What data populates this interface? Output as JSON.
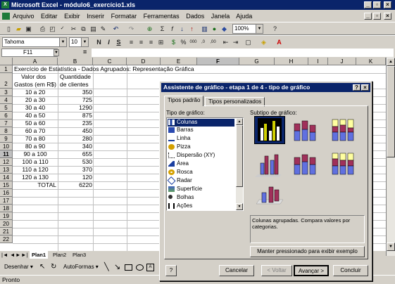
{
  "window": {
    "title": "Microsoft Excel - módulo6_exercício1.xls"
  },
  "menu": [
    "Arquivo",
    "Editar",
    "Exibir",
    "Inserir",
    "Formatar",
    "Ferramentas",
    "Dados",
    "Janela",
    "Ajuda"
  ],
  "toolbar": {
    "zoom": "100%",
    "font": "Tahoma",
    "size": "10"
  },
  "namebox": "F11",
  "columns": [
    "A",
    "B",
    "C",
    "D",
    "E",
    "F",
    "G",
    "H",
    "I",
    "J",
    "K"
  ],
  "rows": [
    "1",
    "2",
    "3",
    "4",
    "5",
    "6",
    "7",
    "8",
    "9",
    "10",
    "11",
    "12",
    "13",
    "14",
    "15",
    "16",
    "17",
    "18",
    "19",
    "20",
    "21",
    "22"
  ],
  "sheet": {
    "title": "Exercício de Estatística - Dados Agrupados: Representação Gráfica",
    "head_a1": "Valor dos",
    "head_a2": "Gastos (em R$)",
    "head_b1": "Quantidade",
    "head_b2": "de clientes",
    "data": [
      {
        "range": "10 a 20",
        "qty": "350"
      },
      {
        "range": "20 a 30",
        "qty": "725"
      },
      {
        "range": "30 a 40",
        "qty": "1290"
      },
      {
        "range": "40 a 50",
        "qty": "875"
      },
      {
        "range": "50 a 60",
        "qty": "235"
      },
      {
        "range": "60 a 70",
        "qty": "450"
      },
      {
        "range": "70 a 80",
        "qty": "280"
      },
      {
        "range": "80 a 90",
        "qty": "340"
      },
      {
        "range": "90 a 100",
        "qty": "655"
      },
      {
        "range": "100 a 110",
        "qty": "530"
      },
      {
        "range": "110 a 120",
        "qty": "370"
      },
      {
        "range": "120 a 130",
        "qty": "120"
      }
    ],
    "total_label": "TOTAL",
    "total_value": "6220"
  },
  "sheet_tabs": [
    "Plan1",
    "Plan2",
    "Plan3"
  ],
  "draw_bar": {
    "draw": "Desenhar",
    "autoshapes": "AutoFormas"
  },
  "status": "Pronto",
  "dialog": {
    "title": "Assistente de gráfico - etapa 1 de 4 - tipo de gráfico",
    "tab_standard": "Tipos padrão",
    "tab_custom": "Tipos personalizados",
    "type_label": "Tipo de gráfico:",
    "subtype_label": "Subtipo de gráfico:",
    "types": [
      "Colunas",
      "Barras",
      "Linha",
      "Pizza",
      "Dispersão (XY)",
      "Área",
      "Rosca",
      "Radar",
      "Superfície",
      "Bolhas",
      "Ações"
    ],
    "description": "Colunas agrupadas. Compara valores por categorias.",
    "preview_button": "Manter pressionado para exibir exemplo",
    "help": "?",
    "cancel": "Cancelar",
    "back": "< Voltar",
    "next": "Avançar >",
    "finish": "Concluir"
  }
}
